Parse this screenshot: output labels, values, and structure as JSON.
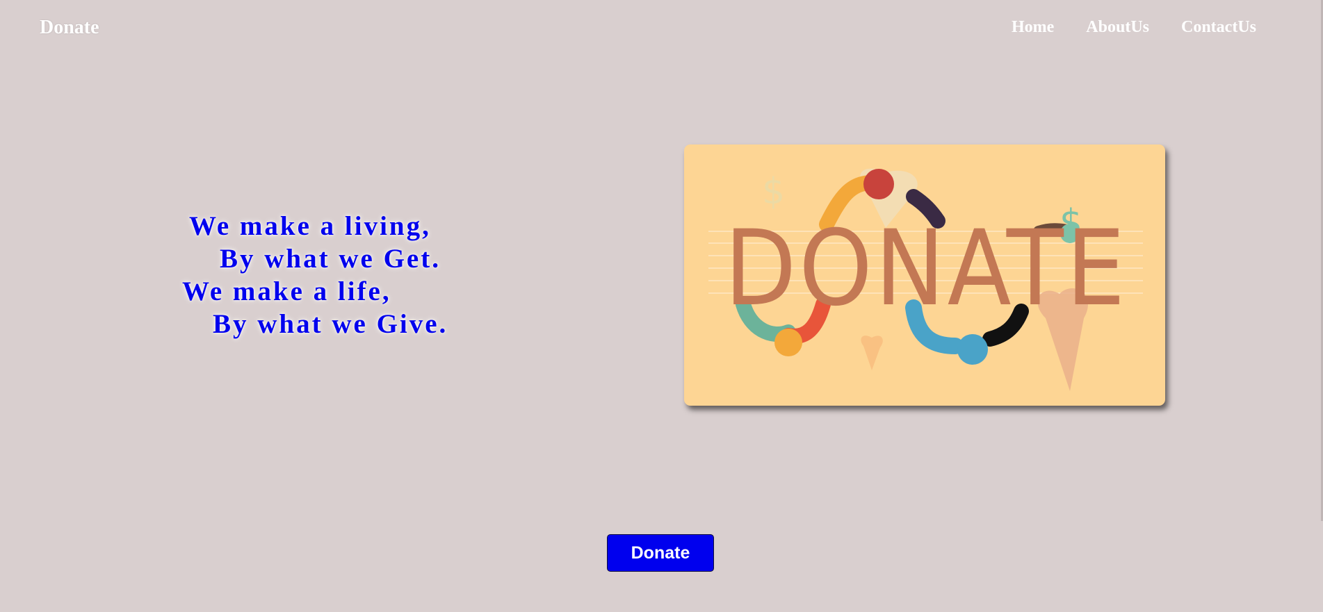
{
  "header": {
    "brand": "Donate",
    "nav": [
      {
        "label": "Home"
      },
      {
        "label": "AboutUs"
      },
      {
        "label": "ContactUs"
      }
    ]
  },
  "quote": {
    "lines": [
      "We make a living,",
      "By what we Get.",
      "We make a life,",
      "By what we Give."
    ]
  },
  "banner": {
    "word": "DONATE",
    "icon_names": [
      "dollar-icon",
      "heart-icon",
      "hands-icon"
    ]
  },
  "cta": {
    "label": "Donate"
  },
  "colors": {
    "background": "#d9cfcf",
    "accent_blue": "#0000ee",
    "banner_bg": "#fdd594",
    "banner_letters": "#c37854"
  }
}
